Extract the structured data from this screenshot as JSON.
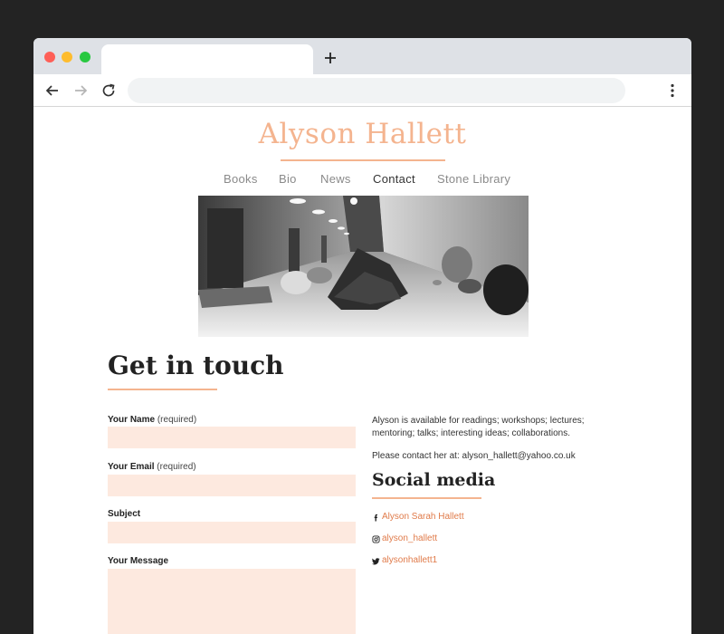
{
  "browser": {
    "new_tab_label": "+",
    "address": ""
  },
  "site": {
    "title": "Alyson Hallett",
    "nav": [
      "Books",
      "Bio",
      "News",
      "Contact",
      "Stone Library"
    ],
    "active_nav": "Contact"
  },
  "hero": {
    "description": "black-and-white photo of stones on a corridor floor"
  },
  "contact": {
    "heading": "Get in touch",
    "fields": [
      {
        "label": "Your Name",
        "note": "(required)"
      },
      {
        "label": "Your Email",
        "note": "(required)"
      },
      {
        "label": "Subject",
        "note": ""
      },
      {
        "label": "Your Message",
        "note": ""
      }
    ]
  },
  "info": {
    "availability": "Alyson is available for readings; workshops; lectures; mentoring; talks; interesting ideas; collaborations.",
    "contact_line": "Please contact her at: alyson_hallett@yahoo.co.uk"
  },
  "social": {
    "heading": "Social media",
    "links": [
      {
        "icon": "facebook-icon",
        "label": "Alyson Sarah Hallett"
      },
      {
        "icon": "instagram-icon",
        "label": "alyson_hallett"
      },
      {
        "icon": "twitter-icon",
        "label": "alysonhallett1"
      }
    ]
  },
  "colors": {
    "accent": "#f4b48f",
    "link": "#e07b4a",
    "field_bg": "#fde9df",
    "page_bg": "#232323"
  }
}
